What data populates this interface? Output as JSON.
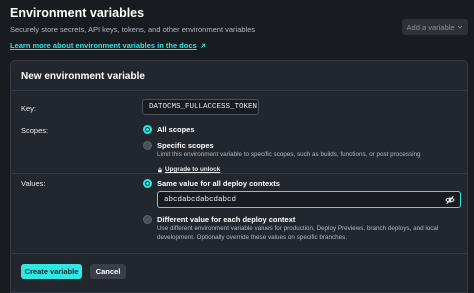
{
  "header": {
    "title": "Environment variables",
    "subtitle": "Securely store secrets, API keys, tokens, and other environment variables",
    "docs_link": "Learn more about environment variables in the docs",
    "add_button": "Add a variable"
  },
  "form": {
    "title": "New environment variable",
    "key_label": "Key:",
    "key_value": "DATOCMS_FULLACCESS_TOKEN",
    "scopes_label": "Scopes:",
    "scope_options": [
      {
        "label": "All scopes",
        "selected": true
      },
      {
        "label": "Specific scopes",
        "selected": false,
        "description": "Limit this environment variable to specific scopes, such as builds, functions, or post processing",
        "upgrade_link": "Upgrade to unlock"
      }
    ],
    "values_label": "Values:",
    "value_options": [
      {
        "label": "Same value for all deploy contexts",
        "selected": true
      },
      {
        "label": "Different value for each deploy context",
        "selected": false,
        "description": "Use different environment variable values for production, Deploy Previews, branch deploys, and local development. Optionally override these values on specific branches."
      }
    ],
    "value_input": "abcdabcdabcdabcd",
    "create_button": "Create variable",
    "cancel_button": "Cancel"
  },
  "colors": {
    "accent": "#32e6e2",
    "background": "#181b20",
    "panel": "#22262d"
  },
  "icons": {
    "docs_link_arrow": "arrow-up-right-icon",
    "add_button_chevron": "chevron-down-icon",
    "upgrade": "lock-icon",
    "value_visibility": "eye-slash-icon"
  }
}
